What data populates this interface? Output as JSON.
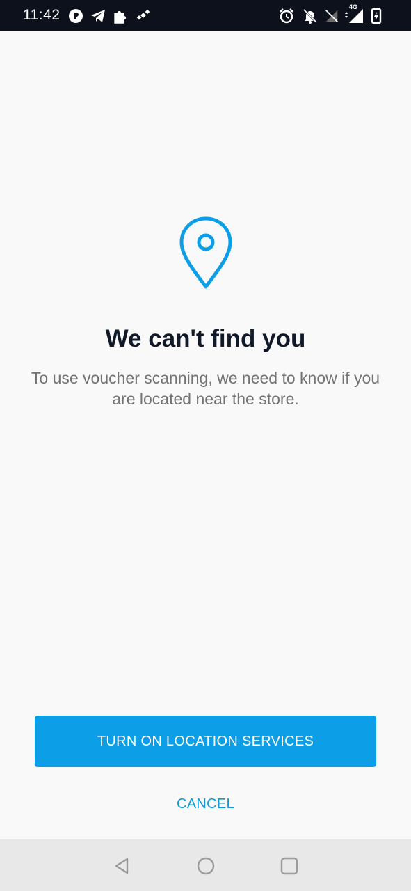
{
  "status_bar": {
    "time": "11:42",
    "network_label": "4G",
    "left_icons": [
      "pocket-casts-icon",
      "telegram-icon",
      "puzzle-icon",
      "satellite-icon"
    ],
    "right_icons": [
      "alarm-icon",
      "bell-off-icon",
      "no-signal-icon",
      "signal-4g-icon",
      "battery-charging-icon"
    ]
  },
  "content": {
    "icon": "location-pin-icon",
    "title": "We can't find you",
    "description": "To use voucher scanning, we need to know if you are located near the store."
  },
  "actions": {
    "primary_label": "TURN ON LOCATION SERVICES",
    "cancel_label": "CANCEL"
  },
  "nav_bar": {
    "buttons": [
      "back-icon",
      "home-icon",
      "recents-icon"
    ]
  },
  "colors": {
    "accent": "#0c9ee6",
    "cancel_text": "#0e9ad8",
    "title_text": "#111827",
    "body_text": "#737373",
    "status_bar_bg": "#0c111b",
    "background": "#f9f9f9",
    "nav_bar_bg": "#e8e8e8"
  }
}
